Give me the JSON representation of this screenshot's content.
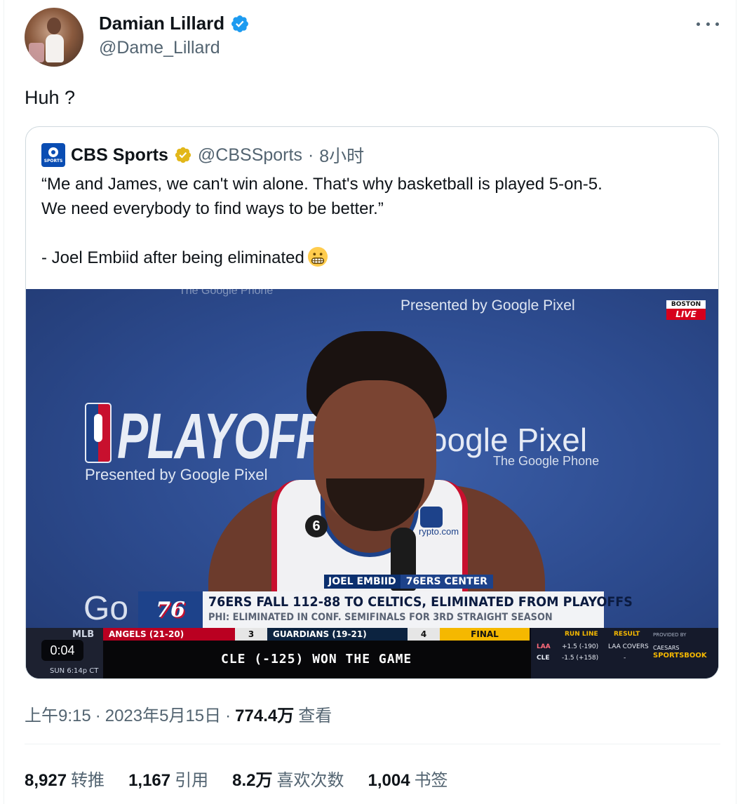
{
  "author": {
    "name": "Damian Lillard",
    "handle": "@Dame_Lillard",
    "verified_color": "#1d9bf0"
  },
  "tweet": {
    "text": "Huh ?"
  },
  "quote": {
    "name": "CBS Sports",
    "handle": "@CBSSports",
    "separator": "·",
    "time": "8小时",
    "badge_color": "#e2b719",
    "lines": [
      "“Me and James, we can't win alone. That's why basketball is played 5-on-5.",
      "We need everybody to find ways to be better.”",
      "",
      "- Joel Embiid after being eliminated"
    ],
    "emoji": "grimacing-face"
  },
  "video": {
    "duration_label": "0:04",
    "background_text": {
      "playoffs": "PLAYOFFS",
      "presented": "Presented by Google Pixel",
      "google_pixel": "oogle Pixel",
      "google_phone": "The Google Phone",
      "goo": "Go",
      "faded": "The Google Phone"
    },
    "live_badge": {
      "top": "BOSTON",
      "bottom": "LIVE"
    },
    "jersey_number": "6",
    "sponsor": "rypto.com",
    "lower_third": {
      "name": "JOEL EMBIID",
      "role": "76ERS CENTER",
      "team_logo": "76",
      "headline": "76ERS FALL 112-88 TO CELTICS, ELIMINATED FROM PLAYOFFS",
      "subhead": "PHI: ELIMINATED IN CONF. SEMIFINALS FOR 3RD STRAIGHT SEASON"
    },
    "ticker": {
      "league": "MLB",
      "time": "SUN 6:14p CT",
      "team1": "ANGELS (21-20)",
      "score1": "3",
      "team2": "GUARDIANS (19-21)",
      "score2": "4",
      "status": "FINAL",
      "result": "CLE (-125) WON THE GAME",
      "odds": {
        "run_line_header": "RUN LINE",
        "result_header": "RESULT",
        "provided_by": "PROVIDED BY",
        "row1_team": "LAA",
        "row1_line": "+1.5 (-190)",
        "row1_result": "LAA COVERS",
        "row2_team": "CLE",
        "row2_line": "-1.5 (+158)",
        "row2_result": "-",
        "sponsor1": "CAESARS",
        "sponsor2": "SPORTSBOOK"
      }
    }
  },
  "meta": {
    "time": "上午9:15",
    "sep1": "·",
    "date": "2023年5月15日",
    "sep2": "·",
    "views": "774.4万",
    "views_label": "查看"
  },
  "stats": [
    {
      "value": "8,927",
      "label": "转推"
    },
    {
      "value": "1,167",
      "label": "引用"
    },
    {
      "value": "8.2万",
      "label": "喜欢次数"
    },
    {
      "value": "1,004",
      "label": "书签"
    }
  ]
}
